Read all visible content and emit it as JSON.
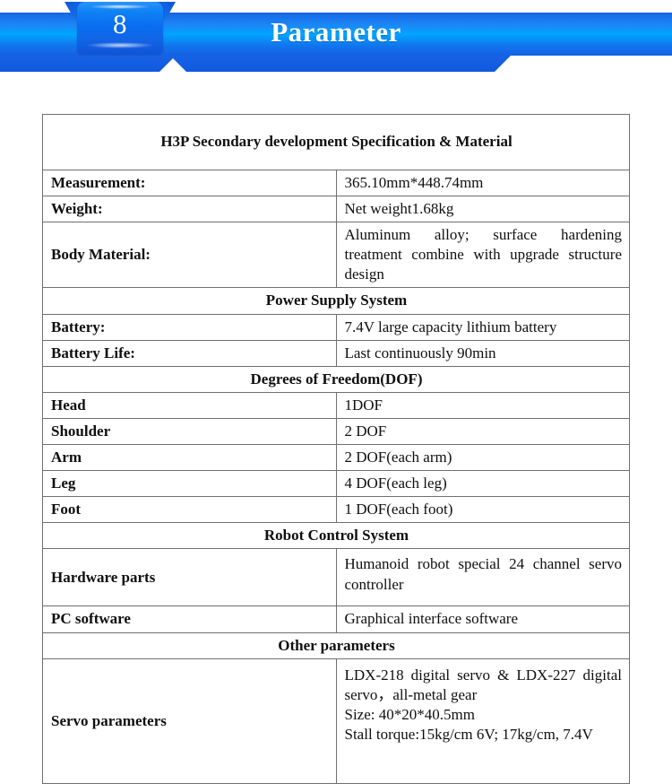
{
  "header": {
    "badge_number": "8",
    "title": "Parameter",
    "accent_blue": "#1d6edb",
    "banner_top_color": "#1565e6",
    "banner_mid_color": "#00a6ff"
  },
  "table": {
    "title": "H3P Secondary development Specification & Material",
    "rows": [
      {
        "type": "pair",
        "label": "Measurement:",
        "value": "365.10mm*448.74mm"
      },
      {
        "type": "pair",
        "label": "Weight:",
        "value": "Net weight1.68kg"
      },
      {
        "type": "pair",
        "label": "Body Material:",
        "value": "Aluminum alloy; surface hardening treatment combine with upgrade structure design"
      },
      {
        "type": "section",
        "label": "Power Supply System"
      },
      {
        "type": "pair",
        "label": "Battery:",
        "value": "7.4V large capacity lithium battery"
      },
      {
        "type": "pair",
        "label": "Battery Life:",
        "value": "Last continuously 90min"
      },
      {
        "type": "section",
        "label": "Degrees of Freedom(DOF)"
      },
      {
        "type": "pair",
        "label": "Head",
        "value": "1DOF"
      },
      {
        "type": "pair",
        "label": "Shoulder",
        "value": "2 DOF"
      },
      {
        "type": "pair",
        "label": "Arm",
        "value": "2 DOF(each arm)"
      },
      {
        "type": "pair",
        "label": "Leg",
        "value": "4 DOF(each leg)"
      },
      {
        "type": "pair",
        "label": "Foot",
        "value": "1 DOF(each foot)"
      },
      {
        "type": "section",
        "label": "Robot Control System"
      },
      {
        "type": "pair",
        "label": "Hardware parts",
        "value": "Humanoid robot special 24 channel servo controller"
      },
      {
        "type": "pair",
        "label": "PC software",
        "value": "Graphical interface software"
      },
      {
        "type": "section",
        "label": "Other parameters"
      },
      {
        "type": "pair",
        "label": "Servo parameters",
        "value_lines": [
          "LDX-218 digital servo & LDX-227 digital servo，all-metal gear",
          "Size: 40*20*40.5mm",
          "Stall torque:15kg/cm 6V; 17kg/cm, 7.4V"
        ]
      }
    ]
  }
}
